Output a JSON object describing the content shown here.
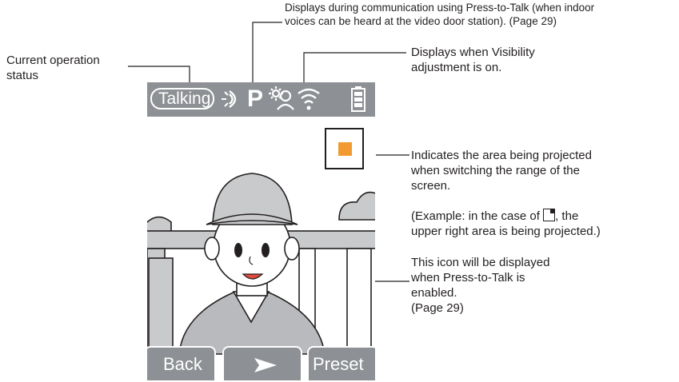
{
  "callouts": {
    "operation_status": "Current operation\nstatus",
    "press_to_talk_display": "Displays during communication using Press-to-Talk (when indoor\nvoices can be heard at the video door station). (Page 29)",
    "visibility": "Displays when Visibility\nadjustment is on.",
    "range": "Indicates the area being projected\nwhen switching the range of the\nscreen.",
    "range_example_prefix": "(Example: in the case of ",
    "range_example_suffix": ", the\nupper right area is being projected.)",
    "press_to_talk_icon": "This icon will be displayed\nwhen Press-to-Talk is\nenabled.\n(Page 29)"
  },
  "screen": {
    "status_label": "Talking",
    "press_to_talk_glyph": "P",
    "buttons": {
      "back": "Back",
      "preset": "Preset"
    }
  },
  "icons": {
    "talk": "talk-waves-icon",
    "press_to_talk": "p-icon",
    "visibility": "visibility-adjust-icon",
    "signal": "wifi-signal-icon",
    "battery": "battery-icon",
    "next": "arrow-right-icon"
  },
  "colors": {
    "bar": "#8d9094",
    "text": "#231f20",
    "range_marker": "#f29a31",
    "cap": "#c9cacc"
  }
}
